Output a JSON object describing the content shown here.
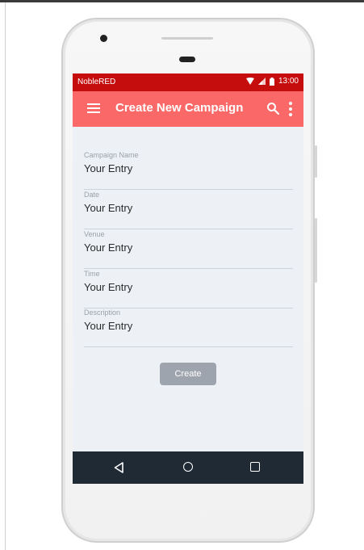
{
  "status_bar": {
    "carrier": "NobleRED",
    "time": "13:00",
    "icons": [
      "wifi-icon",
      "signal-icon",
      "battery-icon"
    ]
  },
  "app_bar": {
    "title": "Create New Campaign",
    "icons": [
      "menu-icon",
      "search-icon",
      "more-vert-icon"
    ]
  },
  "form": {
    "fields": [
      {
        "label": "Campaign Name",
        "value": "Your Entry"
      },
      {
        "label": "Date",
        "value": "Your Entry"
      },
      {
        "label": "Venue",
        "value": "Your Entry"
      },
      {
        "label": "Time",
        "value": "Your Entry"
      },
      {
        "label": "Description",
        "value": "Your Entry"
      }
    ],
    "submit_label": "Create"
  },
  "nav_bar": {
    "icons": [
      "back-icon",
      "home-icon",
      "recents-icon"
    ]
  },
  "colors": {
    "status_bar": "#c60d0d",
    "app_bar": "#fb6868",
    "screen_background": "#edf1f6",
    "button": "#9ea4ad",
    "nav_bar": "#1f2a35"
  }
}
